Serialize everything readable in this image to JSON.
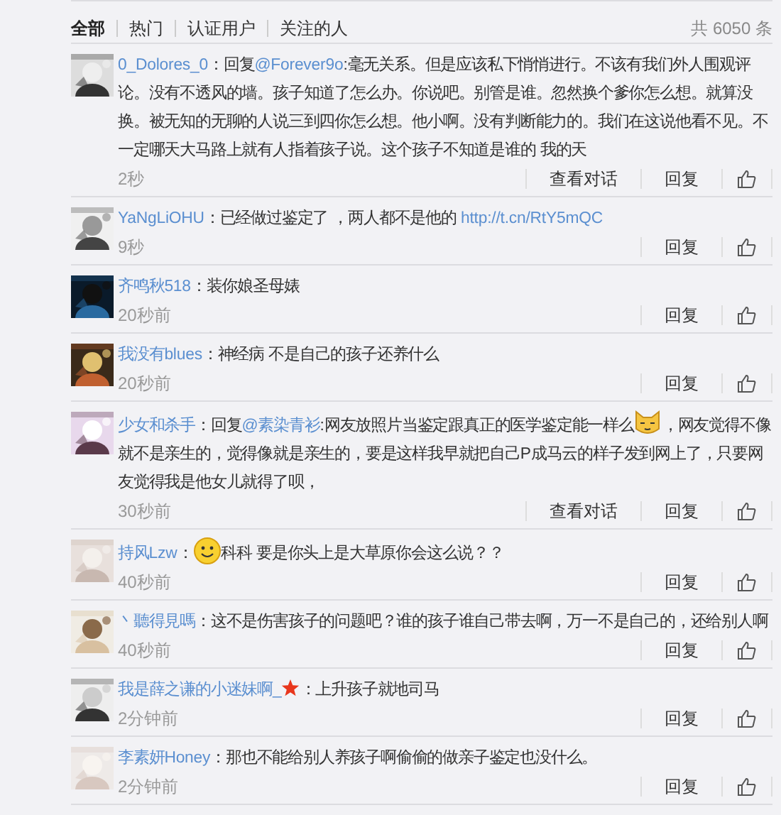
{
  "tabs": [
    {
      "label": "全部",
      "selected": true
    },
    {
      "label": "热门",
      "selected": false
    },
    {
      "label": "认证用户",
      "selected": false
    },
    {
      "label": "关注的人",
      "selected": false
    }
  ],
  "total": "共 6050 条",
  "comments": [
    {
      "user": "0_Dolores_0",
      "parts": [
        {
          "kind": "text",
          "text": "：回复"
        },
        {
          "kind": "mention",
          "text": "@Forever9o"
        },
        {
          "kind": "text",
          "text": ":毫无关系。但是应该私下悄悄进行。不该有我们外人围观评论。没有不透风的墙。孩子知道了怎么办。你说吧。别管是谁。忽然换个爹你怎么想。就算没换。被无知的无聊的人说三到四你怎么想。他小啊。没有判断能力的。我们在这说他看不见。不一定哪天大马路上就有人指着孩子说。这个孩子不知道是谁的 我的天"
        }
      ],
      "time": "2秒",
      "actions": [
        "查看对话",
        "回复"
      ]
    },
    {
      "user": "YaNgLiOHU",
      "parts": [
        {
          "kind": "text",
          "text": "：已经做过鉴定了 ，两人都不是他的 "
        },
        {
          "kind": "link",
          "text": "http://t.cn/RtY5mQC"
        }
      ],
      "time": "9秒",
      "actions": [
        "回复"
      ]
    },
    {
      "user": "齐鸣秋518",
      "parts": [
        {
          "kind": "text",
          "text": "：装你娘圣母婊"
        }
      ],
      "time": "20秒前",
      "actions": [
        "回复"
      ]
    },
    {
      "user": "我没有blues",
      "parts": [
        {
          "kind": "text",
          "text": "：神经病 不是自己的孩子还养什么"
        }
      ],
      "time": "20秒前",
      "actions": [
        "回复"
      ]
    },
    {
      "user": "少女和杀手",
      "parts": [
        {
          "kind": "text",
          "text": "：回复"
        },
        {
          "kind": "mention",
          "text": "@素染青衫"
        },
        {
          "kind": "text",
          "text": ":网友放照片当鉴定跟真正的医学鉴定能一样么"
        },
        {
          "kind": "cat_emoji"
        },
        {
          "kind": "text",
          "text": "，网友觉得不像就不是亲生的，觉得像就是亲生的，要是这样我早就把自己P成马云的样子发到网上了，只要网友觉得我是他女儿就得了呗，"
        }
      ],
      "time": "30秒前",
      "actions": [
        "查看对话",
        "回复"
      ]
    },
    {
      "user": "持风Lzw",
      "parts": [
        {
          "kind": "text",
          "text": "："
        },
        {
          "kind": "smile_emoji"
        },
        {
          "kind": "text",
          "text": "科科 要是你头上是大草原你会这么说？？"
        }
      ],
      "time": "40秒前",
      "actions": [
        "回复"
      ]
    },
    {
      "user": "丶聽得見嗎",
      "parts": [
        {
          "kind": "text",
          "text": "：这不是伤害孩子的问题吧？谁的孩子谁自己带去啊，万一不是自己的，还给别人啊"
        }
      ],
      "time": "40秒前",
      "actions": [
        "回复"
      ]
    },
    {
      "user": "我是薛之谦的小迷妹啊_",
      "starred": true,
      "parts": [
        {
          "kind": "text",
          "text": "：上升孩子就地司马"
        }
      ],
      "time": "2分钟前",
      "actions": [
        "回复"
      ]
    },
    {
      "user": "李素妍Honey",
      "parts": [
        {
          "kind": "text",
          "text": "：那也不能给别人养孩子啊偷偷的做亲子鉴定也没什么。"
        }
      ],
      "time": "2分钟前",
      "actions": [
        "回复"
      ]
    }
  ]
}
